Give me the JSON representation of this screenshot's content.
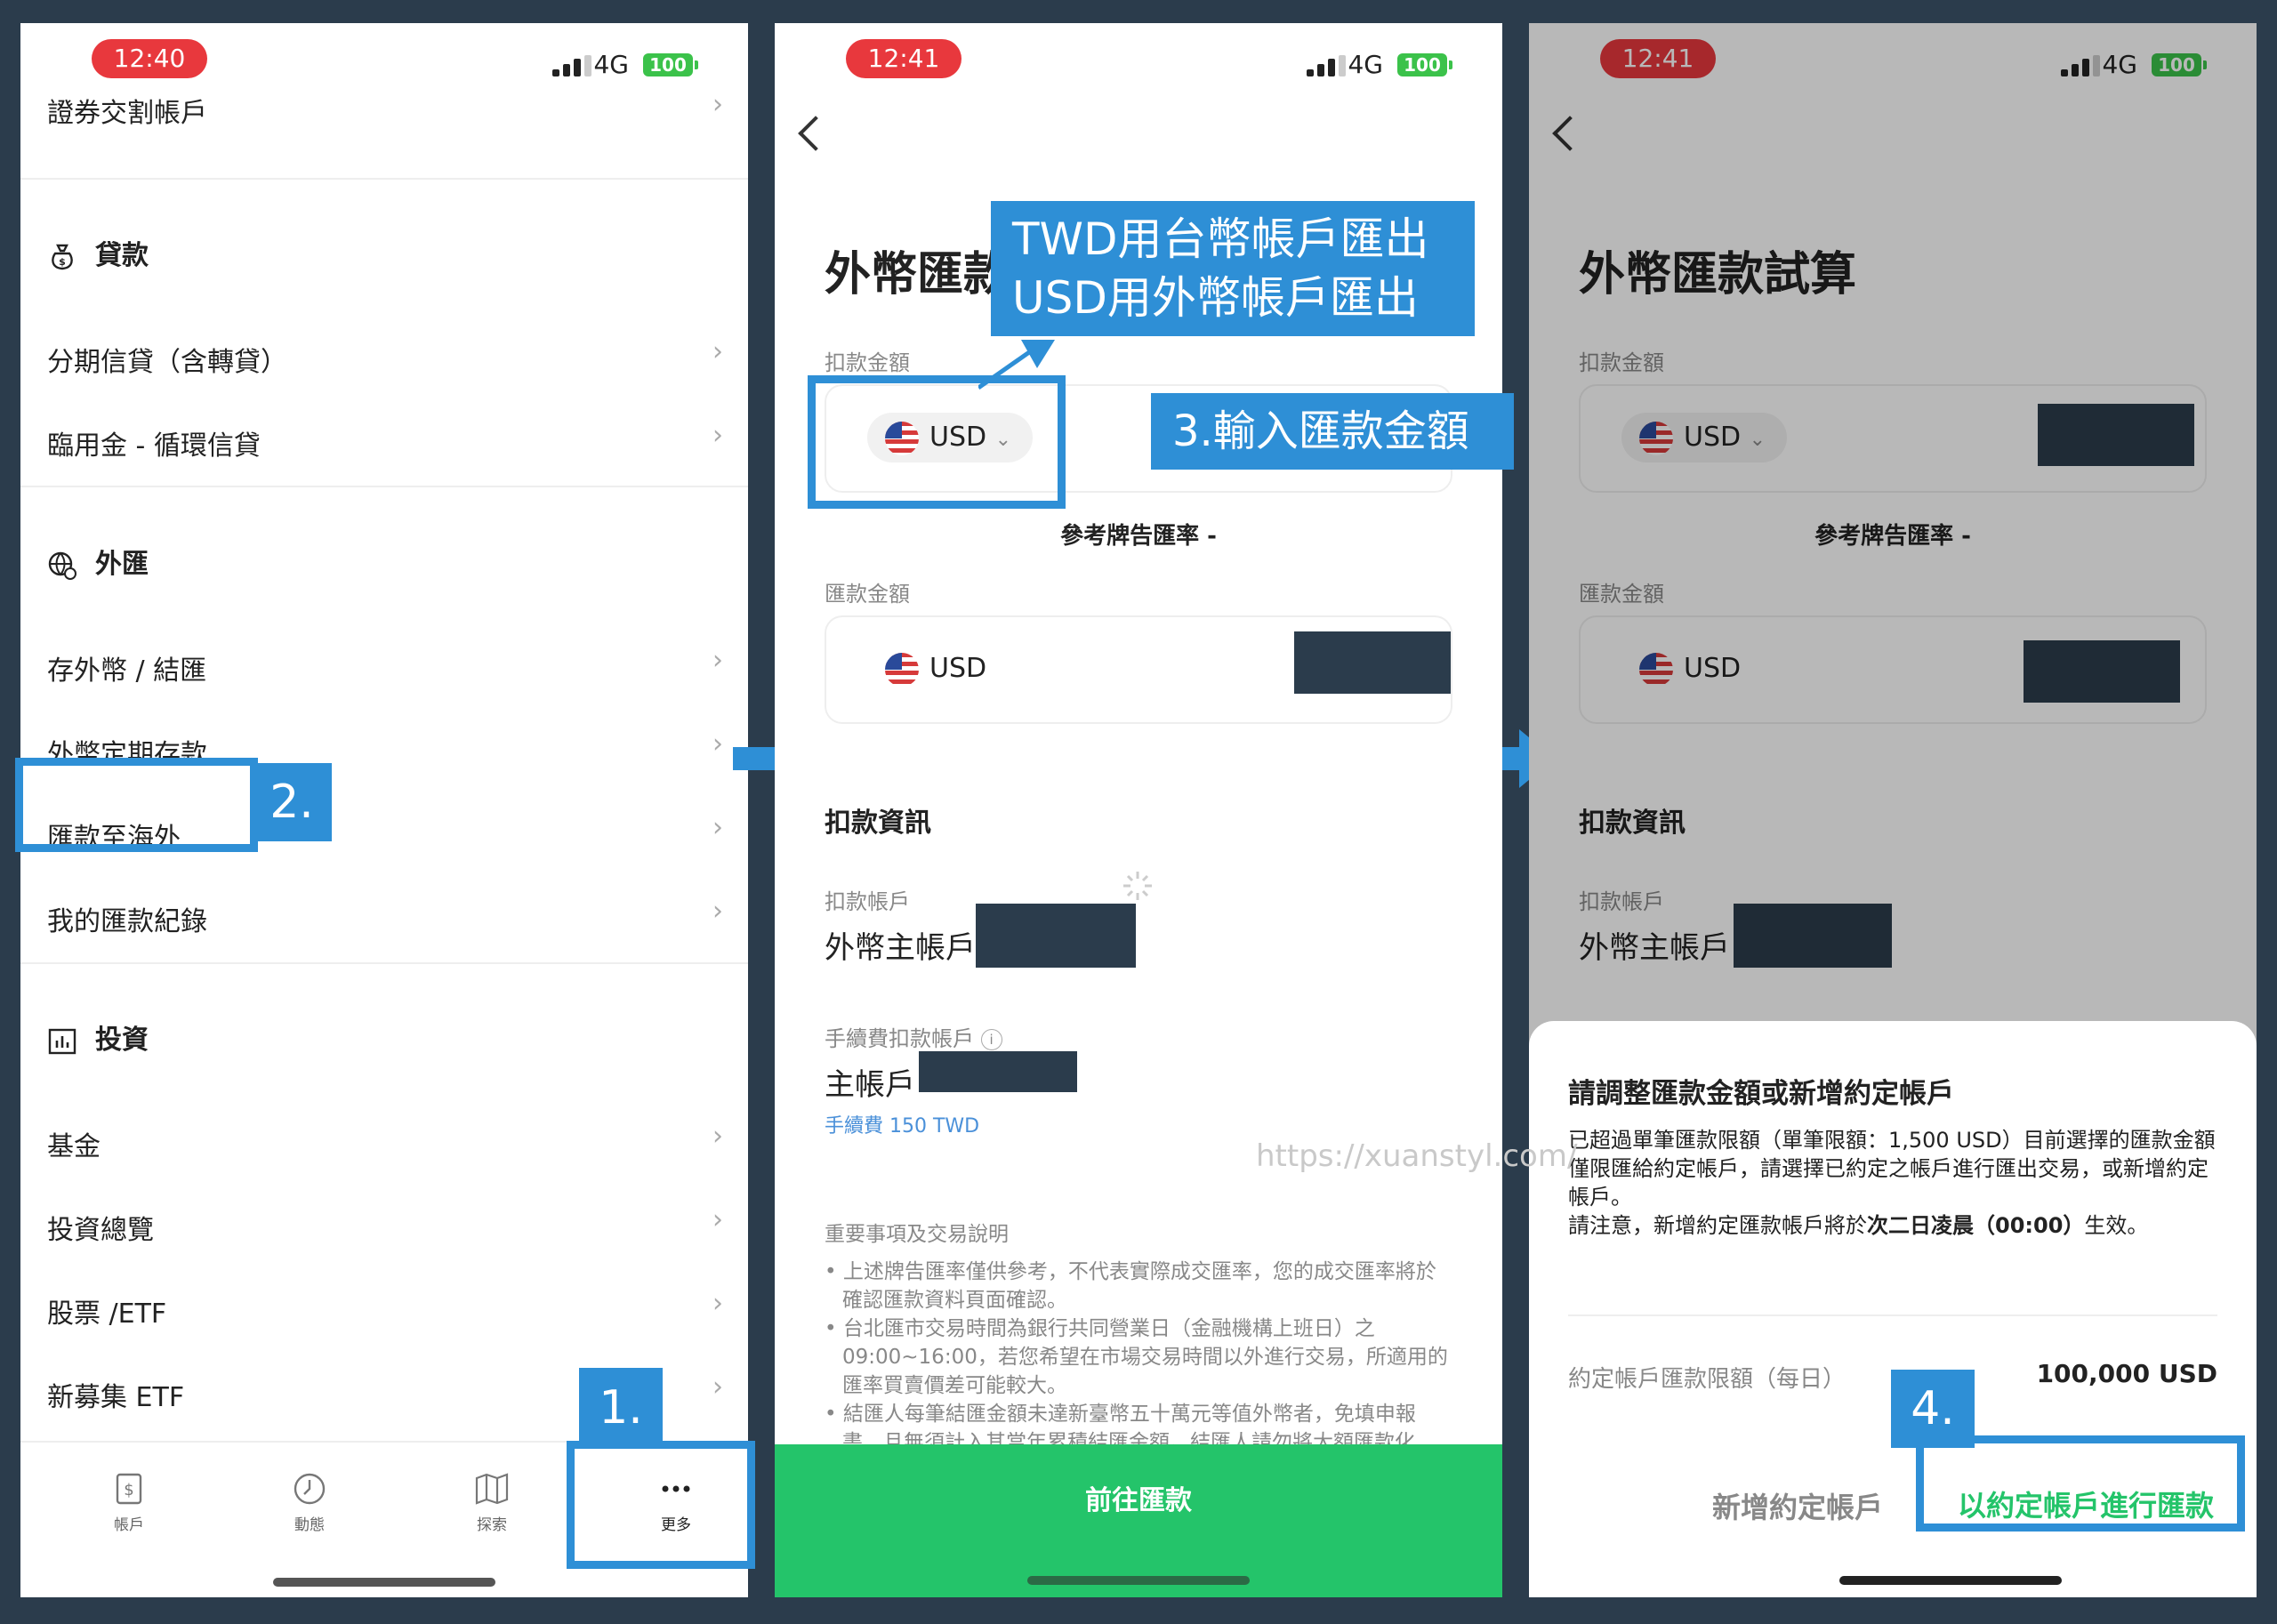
{
  "colors": {
    "accent": "#2e8fd6",
    "brand_green": "#24c46a",
    "time_pill": "#e8383d",
    "battery": "#3bc24a",
    "background": "#2b3c4c"
  },
  "status": {
    "network": "4G",
    "battery": "100",
    "time1": "12:40",
    "time2": "12:41",
    "time3": "12:41"
  },
  "screen1": {
    "top_item": "證券交割帳戶",
    "loans": {
      "title": "貸款",
      "icon": "money-bag-icon",
      "items": [
        "分期信貸（含轉貸）",
        "臨用金 - 循環信貸"
      ]
    },
    "fx": {
      "title": "外匯",
      "icon": "globe-exchange-icon",
      "items": [
        "存外幣 / 結匯",
        "外幣定期存款",
        "匯款至海外",
        "我的匯款紀錄"
      ]
    },
    "invest": {
      "title": "投資",
      "icon": "chart-icon",
      "items": [
        "基金",
        "投資總覽",
        "股票 /ETF",
        "新募集 ETF"
      ]
    },
    "tabs": [
      {
        "label": "帳戶",
        "icon": "dollar-icon"
      },
      {
        "label": "動態",
        "icon": "clock-icon"
      },
      {
        "label": "探索",
        "icon": "map-icon"
      },
      {
        "label": "更多",
        "icon": "more-icon"
      }
    ]
  },
  "screen2": {
    "title": "外幣匯款試算",
    "debit_label": "扣款金額",
    "currency": "USD",
    "rate_text": "參考牌告匯率 -",
    "remit_label": "匯款金額",
    "info_title": "扣款資訊",
    "account_label": "扣款帳戶",
    "account_value": "外幣主帳戶",
    "fee_account_label": "手續費扣款帳戶",
    "fee_account_value": "主帳戶",
    "fee_text": "手續費 150 TWD",
    "notes_title": "重要事項及交易說明",
    "notes": [
      "上述牌告匯率僅供參考，不代表實際成交匯率，您的成交匯率將於確認匯款資料頁面確認。",
      "台北匯市交易時間為銀行共同營業日（金融機構上班日）之 09:00~16:00，若您希望在市場交易時間以外進行交易，所適用的匯率買賣價差可能較大。",
      "結匯人每筆結匯金額未達新臺幣五十萬元等值外幣者，免填申報書，且無須計入其當年累積結匯金額。結匯人請勿將大額匯款化"
    ],
    "go_button": "前往匯款"
  },
  "screen3": {
    "sheet_title": "請調整匯款金額或新增約定帳戶",
    "sheet_body_1": "已超過單筆匯款限額（單筆限額：1,500 USD）目前選擇的匯款金額僅限匯給約定帳戶，請選擇已約定之帳戶進行匯出交易，或新增約定帳戶。",
    "sheet_body_2_prefix": "請注意，新增約定匯款帳戶將於",
    "sheet_body_2_bold": "次二日凌晨（00:00）",
    "sheet_body_2_suffix": "生效。",
    "limit_label": "約定帳戶匯款限額（每日）",
    "limit_value": "100,000 USD",
    "add_button": "新增約定帳戶",
    "use_button": "以約定帳戶進行匯款"
  },
  "annotations": {
    "step1": "1.",
    "step2": "2.",
    "step3": "3.輸入匯款金額",
    "step4": "4.",
    "currency_note_line1": "TWD用台幣帳戶匯出",
    "currency_note_line2": "USD用外幣帳戶匯出"
  },
  "watermark": "https://xuanstyl.com/"
}
